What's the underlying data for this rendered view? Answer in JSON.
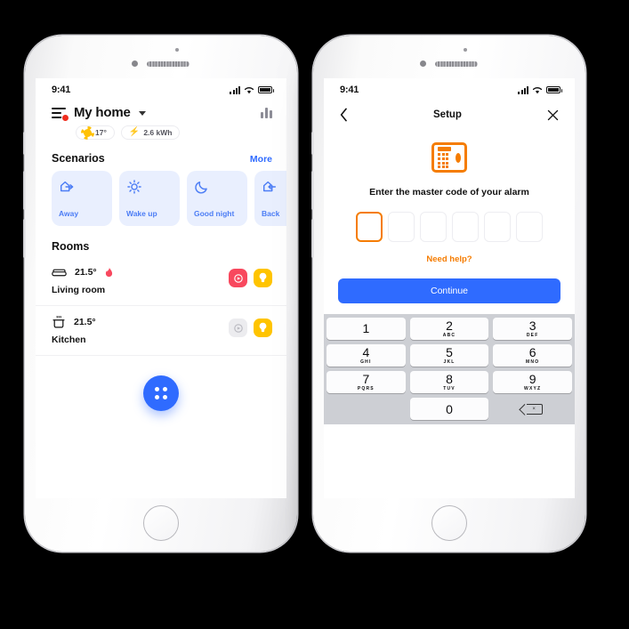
{
  "phones": {
    "left": {
      "status": {
        "time": "9:41",
        "signal_icon": "cellular-bars-icon",
        "wifi_icon": "wifi-icon",
        "battery_icon": "battery-icon"
      }
    },
    "right": {
      "status": {
        "time": "9:41",
        "signal_icon": "cellular-bars-icon",
        "wifi_icon": "wifi-icon",
        "battery_icon": "battery-icon"
      }
    }
  },
  "home": {
    "menu_icon": "hamburger-menu-icon",
    "notification_badge": "notification-dot",
    "title": "My home",
    "dropdown_icon": "chevron-down-icon",
    "stats_icon": "bar-chart-icon",
    "pills": [
      {
        "icon": "sun-icon",
        "value": "17°"
      },
      {
        "icon": "bolt-icon",
        "value": "2.6 kWh"
      }
    ],
    "scenarios": {
      "title": "Scenarios",
      "more_label": "More",
      "cards": [
        {
          "icon": "house-exit-icon",
          "label": "Away"
        },
        {
          "icon": "sun-icon",
          "label": "Wake up"
        },
        {
          "icon": "moon-icon",
          "label": "Good night"
        },
        {
          "icon": "house-enter-icon",
          "label": "Back"
        }
      ]
    },
    "rooms": {
      "title": "Rooms",
      "items": [
        {
          "icon": "sofa-icon",
          "temperature": "21.5°",
          "extra_icon": "flame-icon",
          "name": "Living room",
          "badges": [
            {
              "icon": "siren-icon",
              "state": "on",
              "color": "#F8485E"
            },
            {
              "icon": "light-bulb-icon",
              "state": "on",
              "color": "#FFC400"
            }
          ]
        },
        {
          "icon": "pot-icon",
          "temperature": "21.5°",
          "extra_icon": "",
          "name": "Kitchen",
          "badges": [
            {
              "icon": "siren-icon",
              "state": "off",
              "color": "#ECECEF"
            },
            {
              "icon": "light-bulb-icon",
              "state": "on",
              "color": "#FFC400"
            }
          ]
        }
      ]
    },
    "fab": {
      "icon": "grid-dots-icon",
      "color": "#2F6BFF"
    }
  },
  "setup": {
    "nav": {
      "back_icon": "chevron-left-icon",
      "title": "Setup",
      "close_icon": "close-icon"
    },
    "hero_icon": "alarm-keypad-icon",
    "hero_icon_color": "#F57C00",
    "prompt": "Enter the master code of your alarm",
    "code": {
      "length": 6,
      "active_index": 0,
      "values": [
        "",
        "",
        "",
        "",
        "",
        ""
      ],
      "accent": "#F57C00"
    },
    "help_link": "Need help?",
    "continue_label": "Continue",
    "continue_color": "#2F6BFF",
    "keypad": {
      "keys": [
        {
          "num": "1",
          "sub": ""
        },
        {
          "num": "2",
          "sub": "ABC"
        },
        {
          "num": "3",
          "sub": "DEF"
        },
        {
          "num": "4",
          "sub": "GHI"
        },
        {
          "num": "5",
          "sub": "JKL"
        },
        {
          "num": "6",
          "sub": "MNO"
        },
        {
          "num": "7",
          "sub": "PQRS"
        },
        {
          "num": "8",
          "sub": "TUV"
        },
        {
          "num": "9",
          "sub": "WXYZ"
        },
        {
          "num": "0",
          "sub": ""
        }
      ],
      "delete_icon": "backspace-icon"
    }
  }
}
